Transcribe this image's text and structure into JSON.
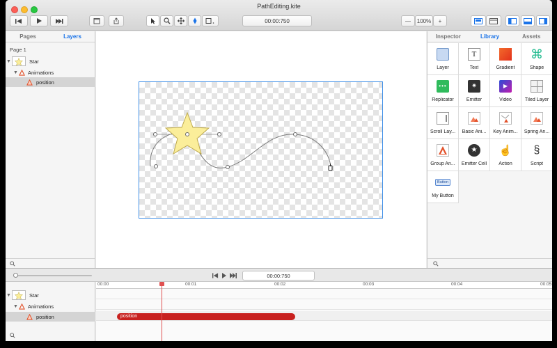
{
  "window": {
    "title": "PathEditing.kite"
  },
  "toolbar": {
    "time": "00:00:750",
    "zoom": "100%",
    "zoom_minus": "—",
    "zoom_plus": "+"
  },
  "left_panel": {
    "tabs": [
      "Pages",
      "Layers"
    ],
    "active_tab": "Layers",
    "page": "Page 1",
    "layers": [
      {
        "label": "Star",
        "kind": "layer"
      },
      {
        "label": "Animations",
        "kind": "group"
      },
      {
        "label": "position",
        "kind": "animation",
        "selected": true
      }
    ]
  },
  "right_panel": {
    "tabs": [
      "Inspector",
      "Library",
      "Assets"
    ],
    "active_tab": "Library",
    "library": [
      {
        "label": "Layer",
        "icon": "layer-icon"
      },
      {
        "label": "Text",
        "icon": "text-icon"
      },
      {
        "label": "Gradient",
        "icon": "gradient-icon"
      },
      {
        "label": "Shape",
        "icon": "shape-icon"
      },
      {
        "label": "Replicator",
        "icon": "replicator-icon"
      },
      {
        "label": "Emitter",
        "icon": "emitter-icon"
      },
      {
        "label": "Video",
        "icon": "video-icon"
      },
      {
        "label": "Tiled Layer",
        "icon": "tiled-layer-icon"
      },
      {
        "label": "Scroll Lay...",
        "icon": "scroll-layer-icon"
      },
      {
        "label": "Basic Ani...",
        "icon": "basic-animation-icon"
      },
      {
        "label": "Key Anim...",
        "icon": "key-animation-icon"
      },
      {
        "label": "Spring An...",
        "icon": "spring-animation-icon"
      },
      {
        "label": "Group An...",
        "icon": "group-animation-icon"
      },
      {
        "label": "Emitter Cell",
        "icon": "emitter-cell-icon"
      },
      {
        "label": "Action",
        "icon": "action-icon"
      },
      {
        "label": "Script",
        "icon": "script-icon"
      },
      {
        "label": "My Button",
        "icon": "my-button-icon",
        "inner": "Button"
      }
    ]
  },
  "timeline": {
    "time": "00:00:750",
    "ticks": [
      "00:00",
      "00:01",
      "00:02",
      "00:03",
      "00:04",
      "00:05"
    ],
    "tracks": [
      {
        "label": "Star"
      },
      {
        "label": "Animations"
      },
      {
        "label": "position"
      }
    ],
    "bar_label": "position"
  },
  "colors": {
    "accent": "#1a73e8",
    "selection": "#3f8fe8",
    "bar": "#c8211f",
    "playhead": "#e05050",
    "star": "#fbee9a"
  }
}
